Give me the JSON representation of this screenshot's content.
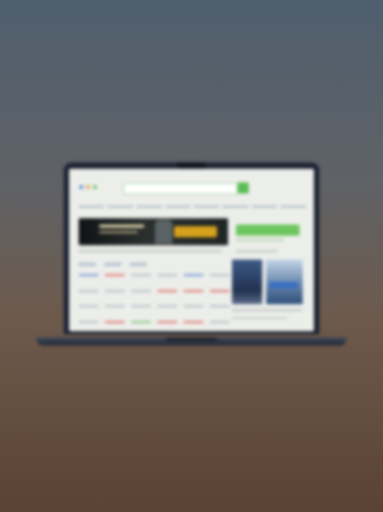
{
  "scene": {
    "description_colors": {
      "background_top": "#4f5f6e",
      "background_bottom": "#5a4234",
      "laptop_body": "#1c2230",
      "accent_green": "#5bbd55",
      "banner_gold": "#d5a21c"
    }
  },
  "laptop": {
    "screen": {
      "logo_letters": [
        {
          "char": "",
          "color": "#3f7de0"
        },
        {
          "char": "",
          "color": "#e0a13f"
        },
        {
          "char": "",
          "color": "#5bbd55"
        }
      ],
      "icons": {
        "search": "search-icon"
      }
    }
  }
}
